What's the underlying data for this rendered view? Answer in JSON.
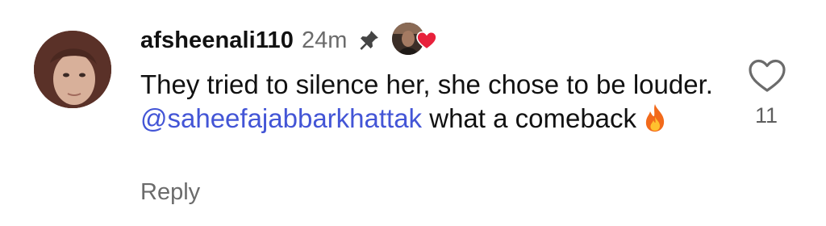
{
  "comment": {
    "username": "afsheenali110",
    "timestamp": "24m",
    "text_before_mention": "They tried to silence her, she chose to be louder. ",
    "mention": "@saheefajabbarkhattak",
    "text_after_mention": " what a comeback",
    "emoji": "fire-icon",
    "reply_label": "Reply",
    "like_count": "11",
    "icons": {
      "pin": "pin-icon",
      "creator_liked": "heart-icon",
      "like": "heart-outline-icon"
    },
    "colors": {
      "text": "#111111",
      "muted": "#6b6b6b",
      "mention": "#4355d6",
      "heart": "#e8213b"
    }
  }
}
